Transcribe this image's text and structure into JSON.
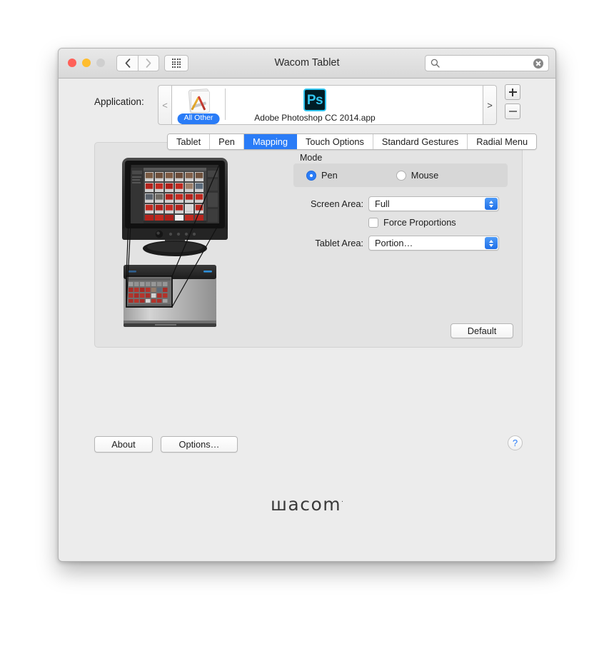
{
  "window": {
    "title": "Wacom Tablet",
    "traffic_lights": [
      "close",
      "minimize",
      "zoom"
    ],
    "nav_back_label": "‹",
    "nav_forward_label": "›",
    "grid_button_name": "show-all-preferences"
  },
  "search": {
    "value": "",
    "placeholder": ""
  },
  "application_row": {
    "label": "Application:",
    "prev_arrow": "<",
    "next_arrow": ">",
    "add_label": "+",
    "remove_label": "−",
    "items": [
      {
        "badge": "All Other",
        "name": "",
        "icon": "generic-app-icon"
      },
      {
        "badge": "",
        "name": "Adobe Photoshop CC 2014.app",
        "icon": "photoshop-icon",
        "icon_text": "Ps"
      }
    ]
  },
  "tabs": [
    {
      "label": "Tablet",
      "active": false
    },
    {
      "label": "Pen",
      "active": false
    },
    {
      "label": "Mapping",
      "active": true
    },
    {
      "label": "Touch Options",
      "active": false
    },
    {
      "label": "Standard Gestures",
      "active": false
    },
    {
      "label": "Radial Menu",
      "active": false
    }
  ],
  "mapping": {
    "mode_label": "Mode",
    "mode_options": [
      {
        "label": "Pen",
        "selected": true
      },
      {
        "label": "Mouse",
        "selected": false
      }
    ],
    "screen_area_label": "Screen Area:",
    "screen_area_value": "Full",
    "force_proportions_label": "Force Proportions",
    "force_proportions_checked": false,
    "tablet_area_label": "Tablet Area:",
    "tablet_area_value": "Portion…",
    "default_button": "Default"
  },
  "footer": {
    "about_label": "About",
    "options_label": "Options…",
    "help_label": "?"
  },
  "branding": {
    "logo_text": "шacom",
    "trademark": "·"
  },
  "colors": {
    "accent_blue": "#2a7cf7",
    "window_bg": "#ececec",
    "panel_bg": "#e3e3e3",
    "titlebar_bg": "#e0e0e0",
    "close_red": "#ff6159",
    "minimize_yellow": "#ffbd2e",
    "zoom_disabled": "#cfcfcf",
    "photoshop_cyan": "#31c5f0",
    "photoshop_dark": "#001d26"
  }
}
